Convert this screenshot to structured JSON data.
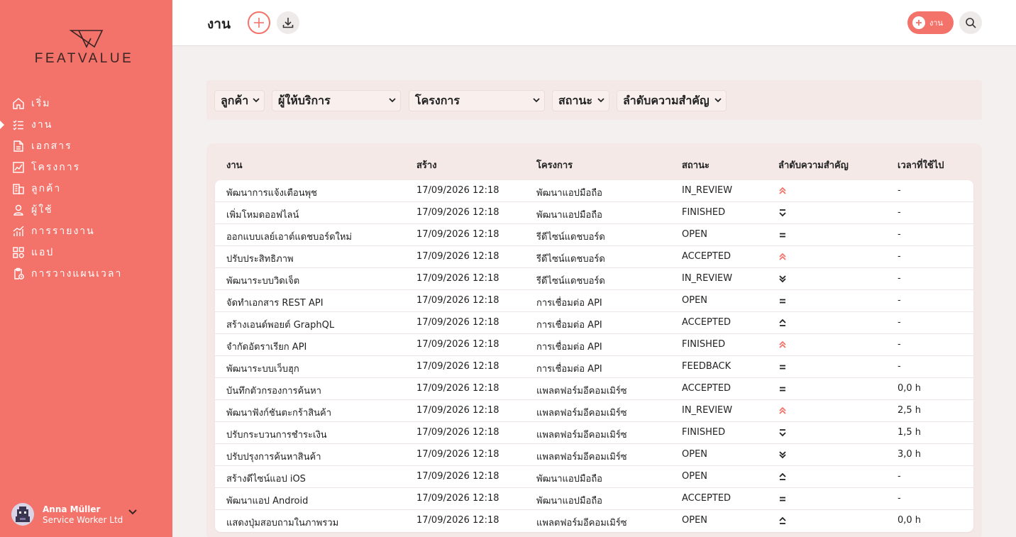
{
  "sidebar": {
    "logo_text": "FEATVALUE",
    "items": [
      {
        "label": "เริ่ม",
        "icon": "home-icon"
      },
      {
        "label": "งาน",
        "icon": "checklist-icon",
        "active": true
      },
      {
        "label": "เอกสาร",
        "icon": "document-icon"
      },
      {
        "label": "โครงการ",
        "icon": "chart-icon"
      },
      {
        "label": "ลูกค้า",
        "icon": "building-icon"
      },
      {
        "label": "ผู้ใช้",
        "icon": "user-icon"
      },
      {
        "label": "การรายงาน",
        "icon": "report-icon"
      },
      {
        "label": "แอป",
        "icon": "apps-icon"
      },
      {
        "label": "การวางแผนเวลา",
        "icon": "clipboard-clock-icon"
      }
    ],
    "user": {
      "name": "Anna Müller",
      "org": "Service Worker Ltd"
    }
  },
  "header": {
    "title": "งาน",
    "new_task_label": "งาน"
  },
  "filters": [
    "ลูกค้า",
    "ผู้ให้บริการ",
    "โครงการ",
    "สถานะ",
    "ลำดับความสำคัญ"
  ],
  "table": {
    "columns": [
      "งาน",
      "สร้าง",
      "โครงการ",
      "สถานะ",
      "ลำดับความสำคัญ",
      "เวลาที่ใช้ไป"
    ],
    "rows": [
      {
        "task": "พัฒนาการแจ้งเตือนพุช",
        "created": "17/09/2026 12:18",
        "project": "พัฒนาแอปมือถือ",
        "status": "IN_REVIEW",
        "priority": "highest",
        "time": "-"
      },
      {
        "task": "เพิ่มโหมดออฟไลน์",
        "created": "17/09/2026 12:18",
        "project": "พัฒนาแอปมือถือ",
        "status": "FINISHED",
        "priority": "low",
        "time": "-"
      },
      {
        "task": "ออกแบบเลย์เอาต์แดชบอร์ดใหม่",
        "created": "17/09/2026 12:18",
        "project": "รีดีไซน์แดชบอร์ด",
        "status": "OPEN",
        "priority": "medium",
        "time": "-"
      },
      {
        "task": "ปรับประสิทธิภาพ",
        "created": "17/09/2026 12:18",
        "project": "รีดีไซน์แดชบอร์ด",
        "status": "ACCEPTED",
        "priority": "highest",
        "time": "-"
      },
      {
        "task": "พัฒนาระบบวิดเจ็ต",
        "created": "17/09/2026 12:18",
        "project": "รีดีไซน์แดชบอร์ด",
        "status": "IN_REVIEW",
        "priority": "lowest",
        "time": "-"
      },
      {
        "task": "จัดทำเอกสาร REST API",
        "created": "17/09/2026 12:18",
        "project": "การเชื่อมต่อ API",
        "status": "OPEN",
        "priority": "medium",
        "time": "-"
      },
      {
        "task": "สร้างเอนด์พอยต์ GraphQL",
        "created": "17/09/2026 12:18",
        "project": "การเชื่อมต่อ API",
        "status": "ACCEPTED",
        "priority": "high",
        "time": "-"
      },
      {
        "task": "จำกัดอัตราเรียก API",
        "created": "17/09/2026 12:18",
        "project": "การเชื่อมต่อ API",
        "status": "FINISHED",
        "priority": "highest",
        "time": "-"
      },
      {
        "task": "พัฒนาระบบเว็บฮุก",
        "created": "17/09/2026 12:18",
        "project": "การเชื่อมต่อ API",
        "status": "FEEDBACK",
        "priority": "medium",
        "time": "-"
      },
      {
        "task": "บันทึกตัวกรองการค้นหา",
        "created": "17/09/2026 12:18",
        "project": "แพลตฟอร์มอีคอมเมิร์ซ",
        "status": "ACCEPTED",
        "priority": "medium",
        "time": "0,0 h"
      },
      {
        "task": "พัฒนาฟังก์ชันตะกร้าสินค้า",
        "created": "17/09/2026 12:18",
        "project": "แพลตฟอร์มอีคอมเมิร์ซ",
        "status": "IN_REVIEW",
        "priority": "highest",
        "time": "2,5 h"
      },
      {
        "task": "ปรับกระบวนการชำระเงิน",
        "created": "17/09/2026 12:18",
        "project": "แพลตฟอร์มอีคอมเมิร์ซ",
        "status": "FINISHED",
        "priority": "low",
        "time": "1,5 h"
      },
      {
        "task": "ปรับปรุงการค้นหาสินค้า",
        "created": "17/09/2026 12:18",
        "project": "แพลตฟอร์มอีคอมเมิร์ซ",
        "status": "OPEN",
        "priority": "lowest",
        "time": "3,0 h"
      },
      {
        "task": "สร้างดีไซน์แอป iOS",
        "created": "17/09/2026 12:18",
        "project": "พัฒนาแอปมือถือ",
        "status": "OPEN",
        "priority": "high",
        "time": "-"
      },
      {
        "task": "พัฒนาแอป Android",
        "created": "17/09/2026 12:18",
        "project": "พัฒนาแอปมือถือ",
        "status": "ACCEPTED",
        "priority": "medium",
        "time": "-"
      },
      {
        "task": "แสดงปุ่มสอบถามในภาพรวม",
        "created": "17/09/2026 12:18",
        "project": "แพลตฟอร์มอีคอมเมิร์ซ",
        "status": "OPEN",
        "priority": "high",
        "time": "0,0 h"
      }
    ]
  },
  "colors": {
    "accent": "#f3736a",
    "sidebar": "#f3736a",
    "priority_highest": "#f3736a"
  }
}
